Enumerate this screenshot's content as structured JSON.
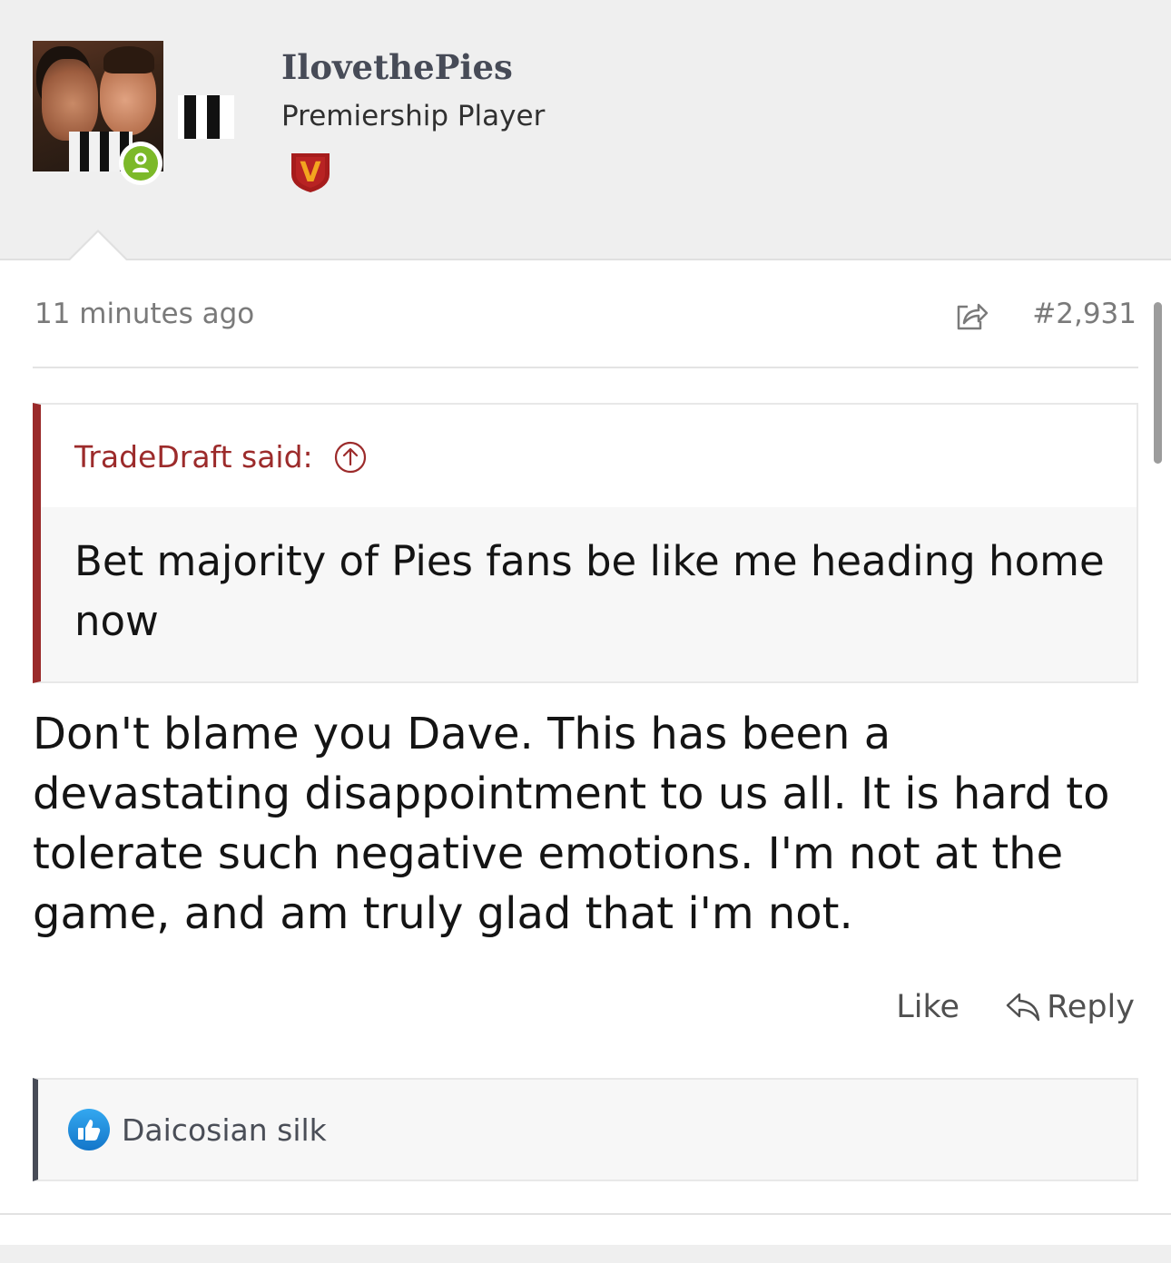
{
  "post": {
    "author": "IlovethePies",
    "author_title": "Premiership Player",
    "timestamp": "11 minutes ago",
    "post_number": "#2,931",
    "quote": {
      "author_line": "TradeDraft said:",
      "text": "Bet majority of Pies fans be like me heading home now"
    },
    "body": "Don't blame you Dave. This has been a devastating disappointment to us all. It is hard to tolerate such negative emotions. I'm not at the game, and am truly glad that i'm not.",
    "actions": {
      "like_label": "Like",
      "reply_label": "Reply"
    },
    "reactions": {
      "icon": "thumbs-up-icon",
      "users": "Daicosian silk"
    }
  },
  "colors": {
    "quote_accent": "#9a2a2a",
    "online_status": "#7cb929",
    "like_reaction": "#1d8fe0",
    "username": "#474b57"
  },
  "badge": {
    "letter": "V"
  }
}
